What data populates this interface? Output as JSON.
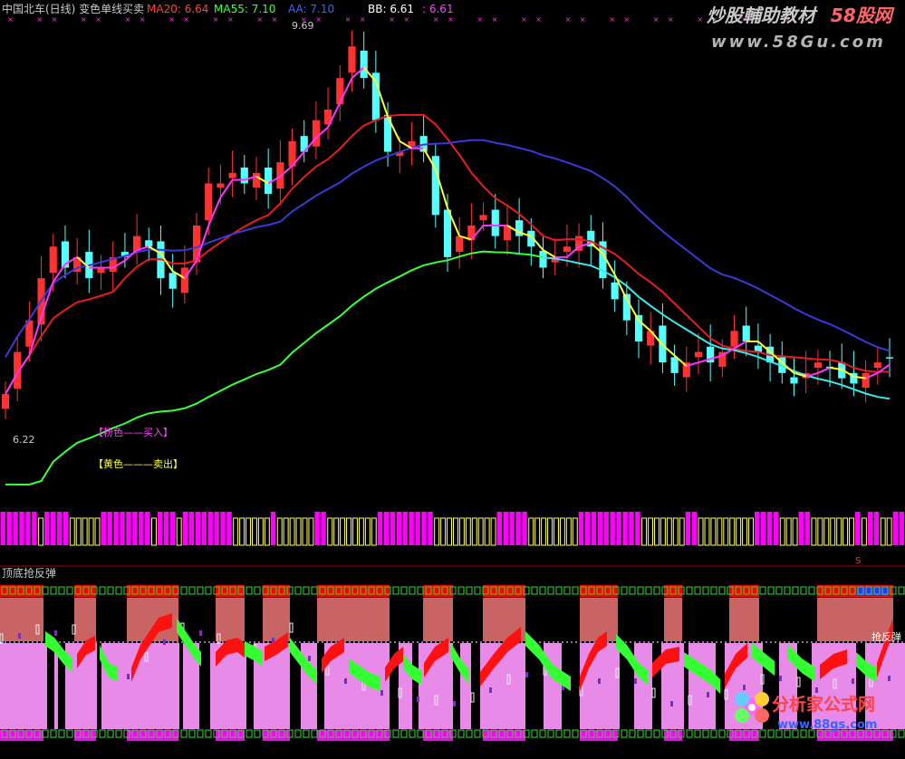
{
  "header": {
    "title": "中国北车(日线) 变色单线买卖",
    "ma20": "MA20: 6.64",
    "ma55": "MA55: 7.10",
    "aa": "AA: 7.10",
    "bb": "BB: 6.61",
    "bb2": ": 6.61"
  },
  "watermark": {
    "top_text": "炒股輔助教材",
    "top_brand": "58股网",
    "top_url": "www.58Gu.com",
    "bottom_brand": "分析家公式网",
    "bottom_url": "www.88gs.com"
  },
  "labels": {
    "high_price": "9.69",
    "low_price": "6.22",
    "legend_pink": "【粉色——买入】",
    "legend_yellow": "【黄色———卖出】",
    "lower_panel_title": "顶底抢反弹",
    "lower_right_label": "抢反弹",
    "s_marker": "S"
  },
  "colors": {
    "background": "#000000",
    "up_candle": "#ff3232",
    "down_candle": "#54ffff",
    "ma20_line": "#e81c1c",
    "ma55_line": "#3a3ad8",
    "long_ma_green": "#3cff3c",
    "long_ma_cyan": "#3ce8e8",
    "signal_pink": "#ff33ff",
    "signal_yellow": "#ffff33",
    "band_red": "#ff0000",
    "band_dull_red": "#c86464",
    "band_pink": "#f08cf0",
    "ribbon_green": "#33ff33",
    "ribbon_red": "#ff1111"
  },
  "chart_data": [
    {
      "type": "candlestick",
      "title": "中国北车(日线) 变色单线买卖",
      "annotations": [
        "9.69",
        "6.22",
        "【粉色——买入】",
        "【黄色———卖出】"
      ],
      "high": 9.69,
      "low": 6.22,
      "series": [
        {
          "name": "MA20",
          "last": 6.64
        },
        {
          "name": "MA55",
          "last": 7.1
        },
        {
          "name": "AA",
          "last": 7.1
        },
        {
          "name": "BB",
          "last": 6.61
        }
      ],
      "close_path": [
        6.3,
        6.7,
        7.0,
        7.4,
        7.7,
        7.5,
        7.6,
        7.4,
        7.5,
        7.6,
        7.6,
        7.8,
        7.7,
        7.4,
        7.3,
        7.5,
        7.9,
        8.3,
        8.3,
        8.4,
        8.3,
        8.4,
        8.2,
        8.5,
        8.7,
        8.6,
        8.9,
        9.0,
        9.3,
        9.6,
        9.3,
        8.9,
        8.6,
        8.6,
        8.7,
        8.6,
        8.0,
        7.6,
        7.8,
        7.9,
        8.0,
        7.8,
        7.9,
        7.8,
        7.7,
        7.5,
        7.6,
        7.7,
        7.8,
        7.7,
        7.4,
        7.2,
        7.0,
        6.8,
        6.9,
        6.6,
        6.5,
        6.6,
        6.7,
        6.6,
        6.7,
        6.9,
        6.8,
        6.7,
        6.6,
        6.5,
        6.4,
        6.5,
        6.6,
        6.55,
        6.45,
        6.4,
        6.5,
        6.6,
        6.64
      ]
    },
    {
      "type": "bar",
      "title": "",
      "signal_bars": [
        "pink",
        "pink",
        "pink",
        "pink",
        "pink",
        "pink",
        "yellow",
        "pink",
        "pink",
        "pink",
        "pink",
        "yellow",
        "yellow",
        "yellow",
        "yellow",
        "yellow",
        "pink",
        "pink",
        "pink",
        "pink",
        "pink",
        "pink",
        "pink",
        "pink",
        "yellow",
        "pink",
        "pink",
        "pink",
        "yellow",
        "pink",
        "pink",
        "pink",
        "pink",
        "pink",
        "pink",
        "pink",
        "pink",
        "yellow",
        "yellow",
        "yellow",
        "yellow",
        "yellow",
        "yellow",
        "pink",
        "yellow",
        "yellow",
        "yellow",
        "yellow",
        "yellow",
        "yellow",
        "pink",
        "pink",
        "yellow",
        "yellow",
        "yellow",
        "yellow",
        "yellow",
        "yellow",
        "yellow",
        "yellow",
        "pink",
        "pink",
        "pink",
        "pink",
        "pink",
        "pink",
        "pink",
        "pink",
        "pink",
        "yellow",
        "yellow",
        "yellow",
        "yellow",
        "yellow",
        "yellow",
        "yellow",
        "yellow",
        "yellow",
        "yellow",
        "pink",
        "pink",
        "pink",
        "pink",
        "pink",
        "yellow",
        "yellow",
        "yellow",
        "yellow",
        "yellow",
        "yellow",
        "yellow",
        "yellow",
        "pink",
        "pink",
        "pink",
        "pink",
        "pink",
        "pink",
        "pink",
        "pink",
        "pink",
        "pink",
        "yellow",
        "yellow",
        "yellow",
        "yellow",
        "yellow",
        "yellow",
        "yellow",
        "pink",
        "pink",
        "yellow",
        "yellow",
        "yellow",
        "yellow",
        "yellow",
        "yellow",
        "yellow",
        "yellow",
        "yellow",
        "pink",
        "pink",
        "pink",
        "pink",
        "yellow",
        "yellow",
        "yellow",
        "pink",
        "pink",
        "yellow",
        "yellow",
        "yellow",
        "yellow",
        "yellow",
        "yellow",
        "yellow",
        "pink",
        "yellow",
        "pink",
        "pink",
        "yellow",
        "yellow",
        "pink",
        "pink"
      ]
    },
    {
      "type": "area",
      "title": "顶底抢反弹",
      "annotations": [
        "抢反弹"
      ],
      "upper_band_segments": [
        [
          0,
          48
        ],
        [
          82,
          106
        ],
        [
          140,
          197
        ],
        [
          238,
          270
        ],
        [
          290,
          320
        ],
        [
          350,
          430
        ],
        [
          467,
          500
        ],
        [
          533,
          580
        ],
        [
          640,
          682
        ],
        [
          733,
          753
        ],
        [
          805,
          838
        ],
        [
          902,
          986
        ]
      ],
      "ribbon_segments": [
        {
          "color": "green",
          "points": [
            [
              50,
              705
            ],
            [
              60,
              712
            ],
            [
              70,
              725
            ],
            [
              80,
              735
            ]
          ]
        },
        {
          "color": "red",
          "points": [
            [
              85,
              730
            ],
            [
              95,
              715
            ],
            [
              105,
              710
            ]
          ]
        },
        {
          "color": "green",
          "points": [
            [
              110,
              720
            ],
            [
              120,
              740
            ],
            [
              130,
              745
            ]
          ]
        },
        {
          "color": "red",
          "points": [
            [
              145,
              745
            ],
            [
              155,
              720
            ],
            [
              165,
              705
            ],
            [
              175,
              690
            ],
            [
              190,
              685
            ]
          ]
        },
        {
          "color": "green",
          "points": [
            [
              195,
              690
            ],
            [
              205,
              705
            ],
            [
              215,
              720
            ],
            [
              222,
              728
            ]
          ]
        },
        {
          "color": "red",
          "points": [
            [
              238,
              728
            ],
            [
              250,
              715
            ],
            [
              262,
              712
            ],
            [
              270,
              718
            ]
          ]
        },
        {
          "color": "green",
          "points": [
            [
              270,
              716
            ],
            [
              282,
              722
            ],
            [
              290,
              728
            ]
          ]
        },
        {
          "color": "red",
          "points": [
            [
              292,
              722
            ],
            [
              305,
              715
            ],
            [
              318,
              706
            ]
          ]
        },
        {
          "color": "green",
          "points": [
            [
              320,
              712
            ],
            [
              330,
              725
            ],
            [
              340,
              738
            ],
            [
              350,
              748
            ]
          ]
        },
        {
          "color": "red",
          "points": [
            [
              355,
              735
            ],
            [
              365,
              722
            ],
            [
              380,
              712
            ]
          ]
        },
        {
          "color": "green",
          "points": [
            [
              385,
              735
            ],
            [
              395,
              742
            ],
            [
              410,
              752
            ],
            [
              420,
              755
            ]
          ]
        },
        {
          "color": "red",
          "points": [
            [
              425,
              745
            ],
            [
              435,
              730
            ],
            [
              445,
              722
            ]
          ]
        },
        {
          "color": "green",
          "points": [
            [
              445,
              730
            ],
            [
              455,
              742
            ],
            [
              465,
              748
            ]
          ]
        },
        {
          "color": "red",
          "points": [
            [
              468,
              740
            ],
            [
              480,
              722
            ],
            [
              495,
              712
            ]
          ]
        },
        {
          "color": "green",
          "points": [
            [
              498,
              718
            ],
            [
              508,
              735
            ],
            [
              518,
              748
            ]
          ]
        },
        {
          "color": "red",
          "points": [
            [
              530,
              750
            ],
            [
              545,
              730
            ],
            [
              560,
              712
            ],
            [
              575,
              700
            ]
          ]
        },
        {
          "color": "green",
          "points": [
            [
              580,
              705
            ],
            [
              595,
              720
            ],
            [
              610,
              742
            ],
            [
              630,
              755
            ]
          ]
        },
        {
          "color": "red",
          "points": [
            [
              640,
              755
            ],
            [
              650,
              730
            ],
            [
              660,
              712
            ],
            [
              670,
              705
            ]
          ]
        },
        {
          "color": "green",
          "points": [
            [
              680,
              708
            ],
            [
              692,
              720
            ],
            [
              705,
              740
            ],
            [
              715,
              748
            ]
          ]
        },
        {
          "color": "red",
          "points": [
            [
              720,
              740
            ],
            [
              735,
              725
            ],
            [
              750,
              722
            ]
          ]
        },
        {
          "color": "green",
          "points": [
            [
              755,
              728
            ],
            [
              770,
              738
            ],
            [
              785,
              748
            ],
            [
              795,
              758
            ]
          ]
        },
        {
          "color": "red",
          "points": [
            [
              800,
              752
            ],
            [
              812,
              730
            ],
            [
              825,
              718
            ]
          ]
        },
        {
          "color": "green",
          "points": [
            [
              830,
              718
            ],
            [
              845,
              730
            ],
            [
              855,
              738
            ]
          ]
        },
        {
          "color": "green",
          "points": [
            [
              870,
              720
            ],
            [
              885,
              735
            ],
            [
              900,
              745
            ]
          ]
        },
        {
          "color": "red",
          "points": [
            [
              905,
              742
            ],
            [
              920,
              730
            ],
            [
              935,
              725
            ]
          ]
        },
        {
          "color": "green",
          "points": [
            [
              945,
              728
            ],
            [
              958,
              740
            ],
            [
              968,
              745
            ]
          ]
        },
        {
          "color": "red",
          "points": [
            [
              968,
              740
            ],
            [
              978,
              712
            ],
            [
              986,
              690
            ]
          ]
        }
      ]
    }
  ]
}
